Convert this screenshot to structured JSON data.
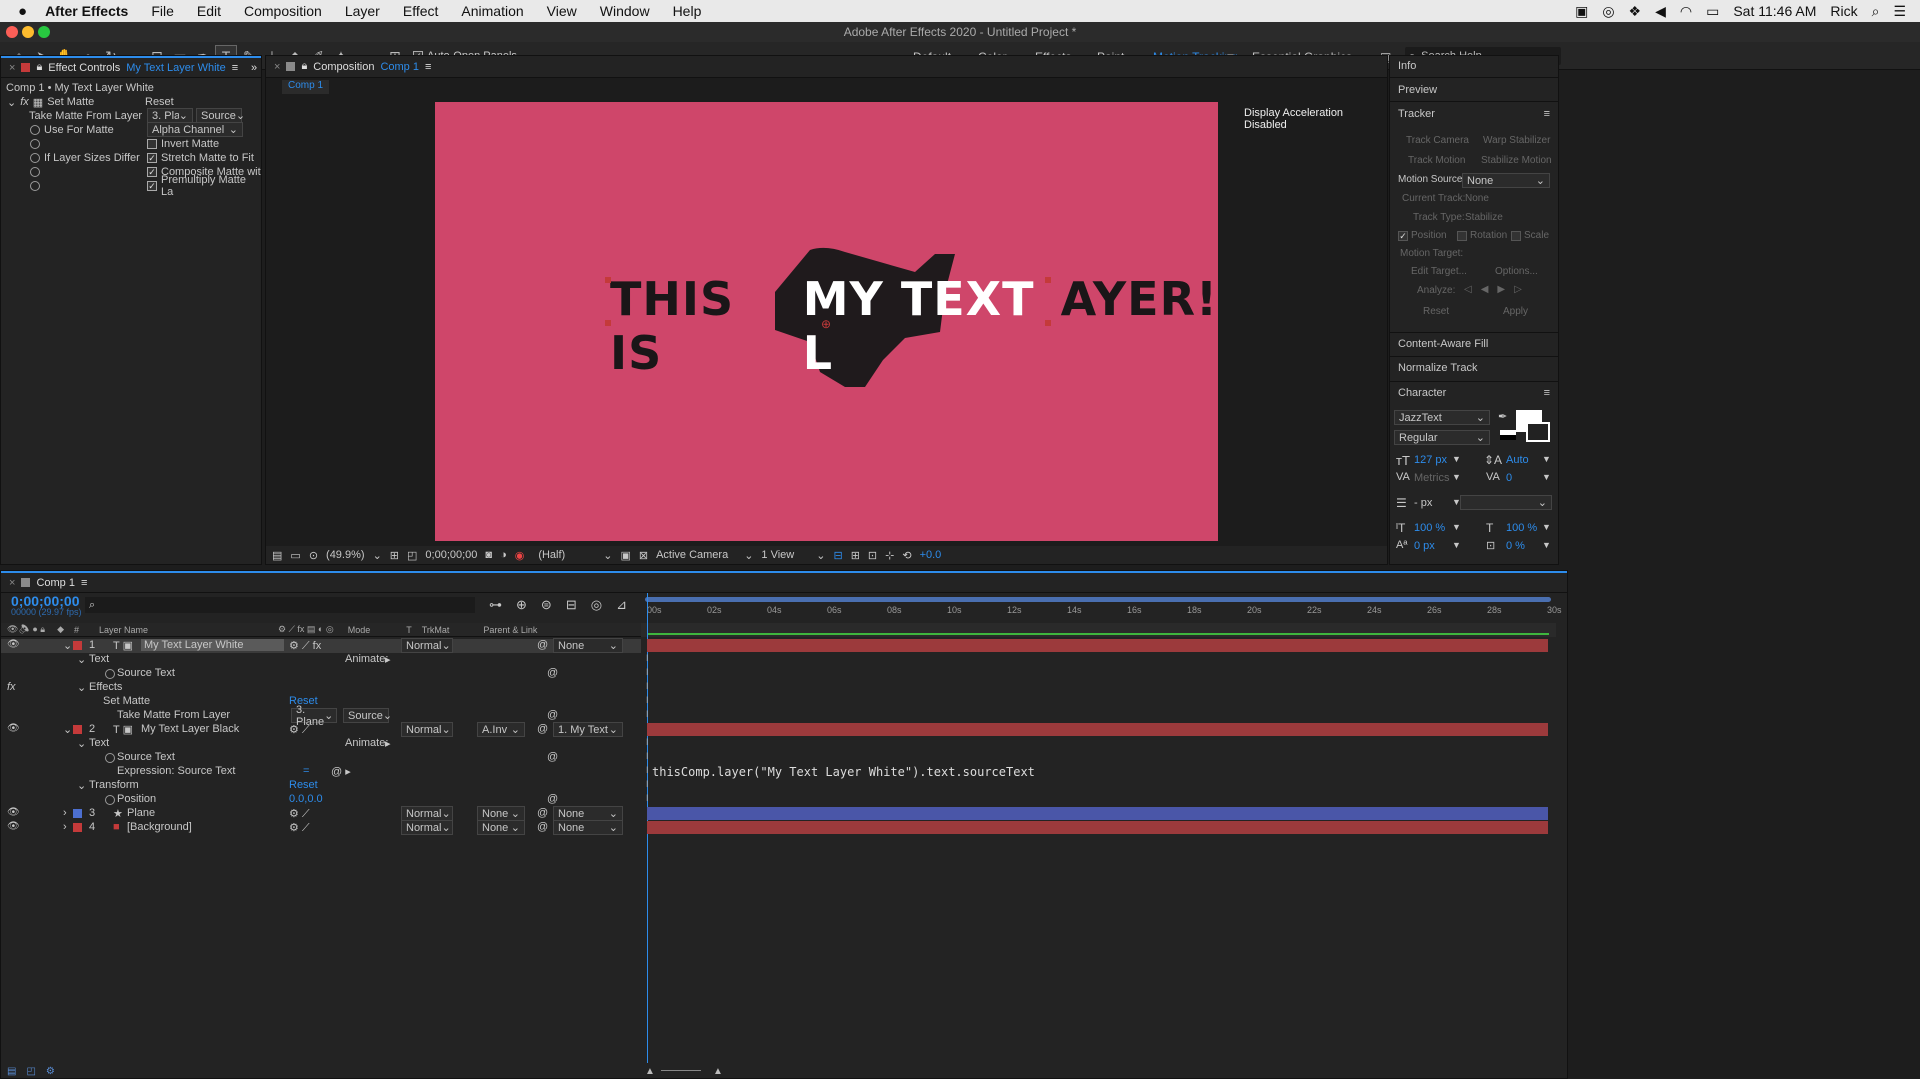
{
  "menubar": {
    "apple": "",
    "app": "After Effects",
    "items": [
      "File",
      "Edit",
      "Composition",
      "Layer",
      "Effect",
      "Animation",
      "View",
      "Window",
      "Help"
    ],
    "clock": "Sat 11:46 AM",
    "user": "Rick"
  },
  "title": "Adobe After Effects 2020 - Untitled Project *",
  "toolbar": {
    "auto_open": "Auto-Open Panels",
    "workspaces": [
      "Default",
      "Color",
      "Effects",
      "Paint",
      "Motion Tracking",
      "Essential Graphics"
    ],
    "search": "Search Help"
  },
  "effect_controls": {
    "tab": "Effect Controls",
    "layer": "My Text Layer White",
    "crumb": "Comp 1 • My Text Layer White",
    "effect": "Set Matte",
    "reset": "Reset",
    "take_matte": "Take Matte From Layer",
    "take_val": "3. Plane",
    "source": "Source",
    "use_for": "Use For Matte",
    "use_val": "Alpha Channel",
    "invert": "Invert Matte",
    "if_sizes": "If Layer Sizes Differ",
    "stretch": "Stretch Matte to Fit",
    "composite": "Composite Matte wit",
    "premultiply": "Premultiply Matte La"
  },
  "composition": {
    "tab": "Composition",
    "comp": "Comp 1",
    "subtab": "Comp 1",
    "accel": "Display Acceleration Disabled",
    "text_black": "THIS IS",
    "text_white": "MY TEXT L",
    "text_black2": "AYER!",
    "zoom": "(49.9%)",
    "time": "0;00;00;00",
    "res": "(Half)",
    "camera": "Active Camera",
    "view": "1 View",
    "exposure": "+0.0",
    "bg": "#cf466a"
  },
  "right": {
    "info": "Info",
    "preview": "Preview",
    "tracker": "Tracker",
    "track_camera": "Track Camera",
    "warp": "Warp Stabilizer",
    "track_motion": "Track Motion",
    "stabilize": "Stabilize Motion",
    "motion_source": "Motion Source:",
    "ms_val": "None",
    "current_track": "Current Track:",
    "ct_val": "None",
    "track_type": "Track Type:",
    "tt_val": "Stabilize",
    "position": "Position",
    "rotation": "Rotation",
    "scale": "Scale",
    "motion_target": "Motion Target:",
    "edit_target": "Edit Target...",
    "options": "Options...",
    "analyze": "Analyze:",
    "reset": "Reset",
    "apply": "Apply",
    "caf": "Content-Aware Fill",
    "normalize": "Normalize Track",
    "character": "Character",
    "font": "JazzText",
    "style": "Regular",
    "size": "127 px",
    "leading": "Auto",
    "kern": "Metrics",
    "track": "0",
    "stroke": "- px",
    "vscale": "100 %",
    "hscale": "100 %",
    "baseline": "0 px",
    "tsume": "0 %"
  },
  "timeline": {
    "tab": "Comp 1",
    "time": "0;00;00;00",
    "fps": "00000 (29.97 fps)",
    "cols": {
      "layer_name": "Layer Name",
      "mode": "Mode",
      "t": "T",
      "trkmat": "TrkMat",
      "parent": "Parent & Link",
      "num": "#"
    },
    "ticks": [
      "00s",
      "02s",
      "04s",
      "06s",
      "08s",
      "10s",
      "12s",
      "14s",
      "16s",
      "18s",
      "20s",
      "22s",
      "24s",
      "26s",
      "28s",
      "30s"
    ],
    "layers": [
      {
        "num": "1",
        "name": "My Text Layer White",
        "mode": "Normal",
        "trk": "",
        "parent": "None",
        "color": "#c43a3a"
      },
      {
        "num": "2",
        "name": "My Text Layer Black",
        "mode": "Normal",
        "trk": "A.Inv",
        "parent": "1. My Text Lay",
        "color": "#c43a3a"
      },
      {
        "num": "3",
        "name": "Plane",
        "mode": "Normal",
        "trk": "None",
        "parent": "None",
        "color": "#4c6fd0"
      },
      {
        "num": "4",
        "name": "[Background]",
        "mode": "Normal",
        "trk": "None",
        "parent": "None",
        "color": "#c43a3a"
      }
    ],
    "text": "Text",
    "animate": "Animate:",
    "source_text": "Source Text",
    "effects": "Effects",
    "set_matte": "Set Matte",
    "reset": "Reset",
    "take_matte": "Take Matte From Layer",
    "plane": "3. Plane",
    "source": "Source",
    "expr_label": "Expression: Source Text",
    "expr_eq": "=",
    "expression": "thisComp.layer(\"My Text Layer White\").text.sourceText",
    "transform": "Transform",
    "position": "Position",
    "pos_val": "0.0,0.0"
  }
}
